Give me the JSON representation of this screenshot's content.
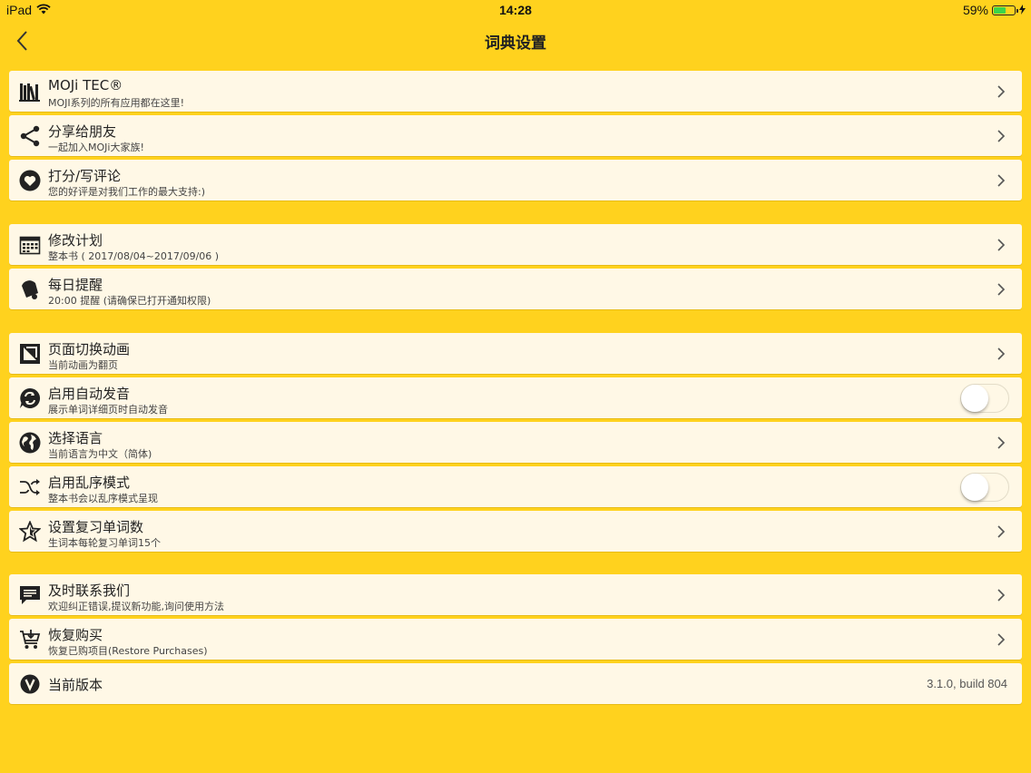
{
  "status_bar": {
    "device": "iPad",
    "time": "14:28",
    "battery_percent": "59%",
    "battery_level": 0.59,
    "battery_color": "#3DD44A"
  },
  "nav": {
    "title": "词典设置",
    "back_icon": "chevron-left-icon"
  },
  "theme": {
    "background": "#FFD21E",
    "row_background": "#FFF8E6"
  },
  "groups": [
    {
      "rows": [
        {
          "icon": "books-icon",
          "title": "MOJi TEC®",
          "subtitle": "MOJI系列的所有应用都在这里!"
        },
        {
          "icon": "share-icon",
          "title": "分享给朋友",
          "subtitle": "一起加入MOJi大家族!"
        },
        {
          "icon": "heart-icon",
          "title": "打分/写评论",
          "subtitle": "您的好评是对我们工作的最大支持:)"
        }
      ]
    },
    {
      "rows": [
        {
          "icon": "calendar-icon",
          "title": "修改计划",
          "subtitle": "整本书 ( 2017/08/04~2017/09/06 )"
        },
        {
          "icon": "bell-icon",
          "title": "每日提醒",
          "subtitle": "20:00 提醒 (请确保已打开通知权限)"
        }
      ]
    },
    {
      "rows": [
        {
          "icon": "page-flip-icon",
          "title": "页面切换动画",
          "subtitle": "当前动画为翻页"
        },
        {
          "icon": "auto-sound-icon",
          "title": "启用自动发音",
          "subtitle": "展示单词详细页时自动发音",
          "toggle": false
        },
        {
          "icon": "globe-icon",
          "title": "选择语言",
          "subtitle": "当前语言为中文（简体)"
        },
        {
          "icon": "shuffle-icon",
          "title": "启用乱序模式",
          "subtitle": "整本书会以乱序模式呈现",
          "toggle": false
        },
        {
          "icon": "star-icon",
          "title": "设置复习单词数",
          "subtitle": "生词本每轮复习单词15个"
        }
      ]
    },
    {
      "rows": [
        {
          "icon": "chat-icon",
          "title": "及时联系我们",
          "subtitle": "欢迎纠正错误,提议新功能,询问使用方法"
        },
        {
          "icon": "cart-icon",
          "title": "恢复购买",
          "subtitle": "恢复已购项目(Restore Purchases)"
        },
        {
          "icon": "version-icon",
          "title": "当前版本",
          "value": "3.1.0, build 804"
        }
      ]
    }
  ]
}
